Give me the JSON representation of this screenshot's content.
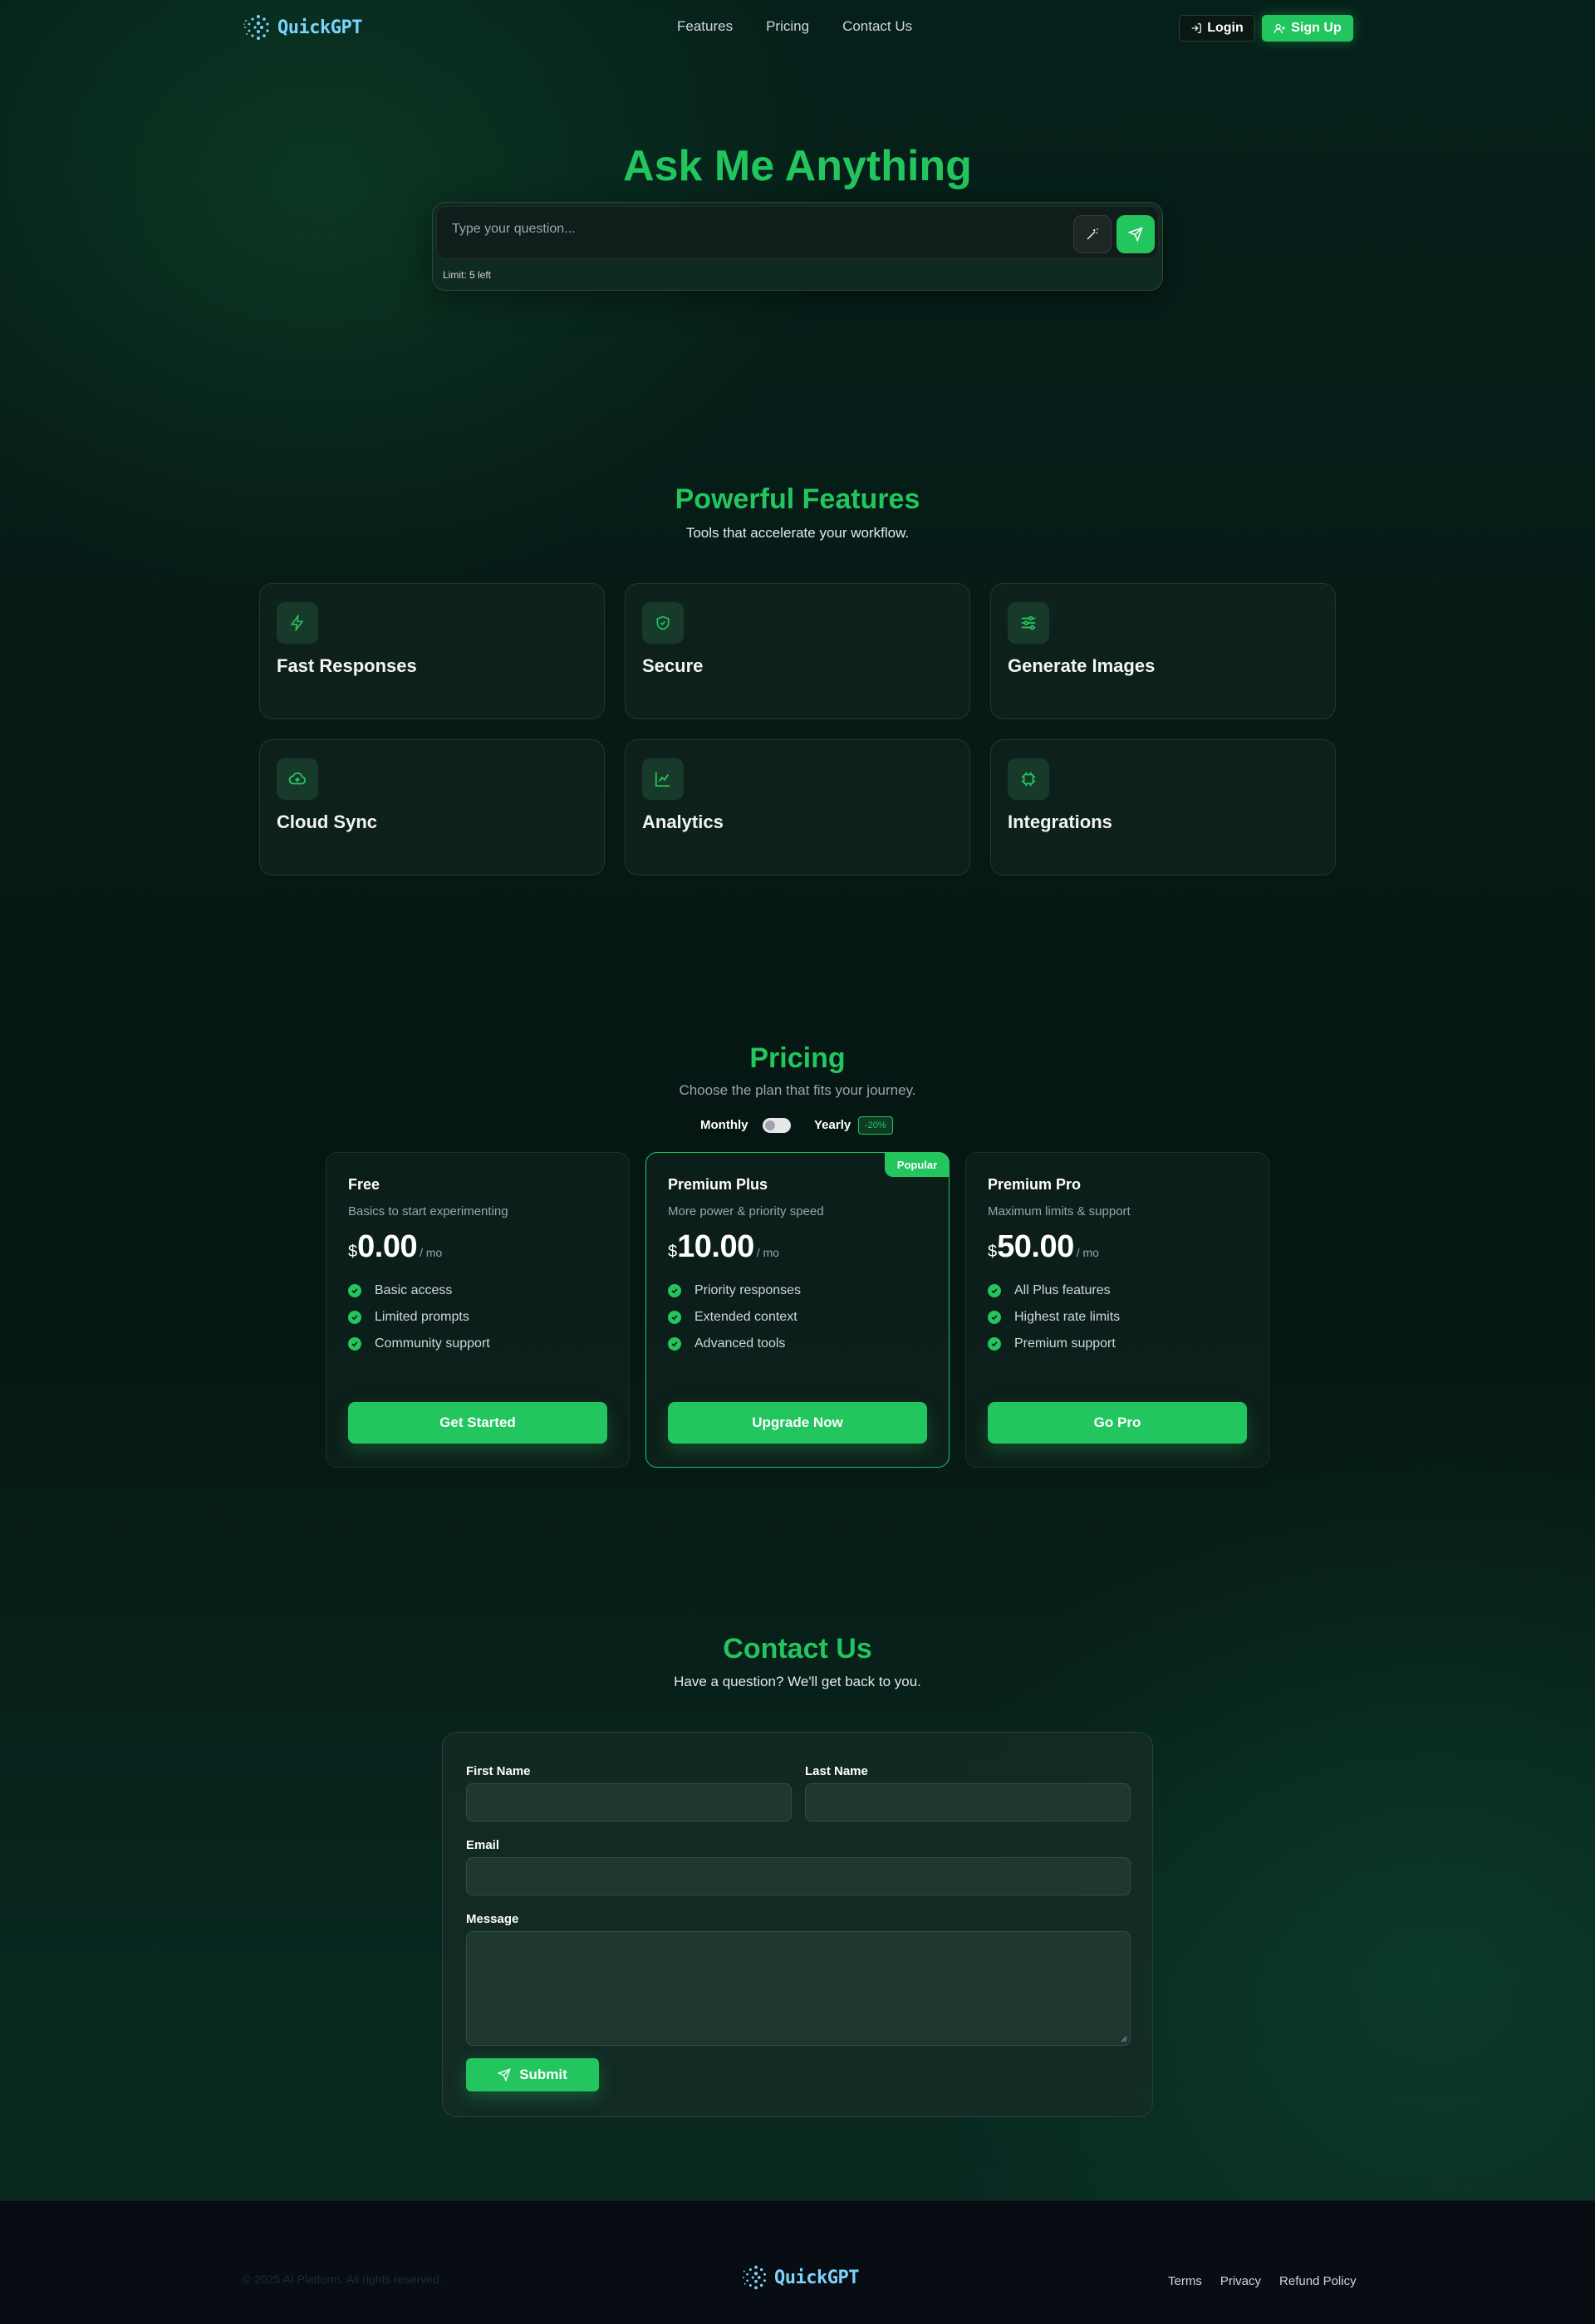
{
  "brand": {
    "name": "QuickGPT"
  },
  "nav": {
    "links": [
      "Features",
      "Pricing",
      "Contact Us"
    ],
    "login_label": "Login",
    "signup_label": "Sign Up"
  },
  "hero": {
    "title": "Ask Me Anything",
    "placeholder": "Type your question...",
    "limit_text": "Limit: 5 left"
  },
  "features": {
    "title": "Powerful Features",
    "subtitle": "Tools that accelerate your workflow.",
    "items": [
      {
        "title": "Fast Responses",
        "icon": "bolt-icon"
      },
      {
        "title": "Secure",
        "icon": "shield-icon"
      },
      {
        "title": "Generate Images",
        "icon": "sliders-icon"
      },
      {
        "title": "Cloud Sync",
        "icon": "cloud-upload-icon"
      },
      {
        "title": "Analytics",
        "icon": "chart-line-icon"
      },
      {
        "title": "Integrations",
        "icon": "chip-icon"
      }
    ]
  },
  "pricing": {
    "title": "Pricing",
    "subtitle": "Choose the plan that fits your journey.",
    "toggle": {
      "monthly": "Monthly",
      "yearly": "Yearly",
      "discount": "-20%",
      "yearly_selected": false
    },
    "plans": [
      {
        "name": "Free",
        "desc": "Basics to start experimenting",
        "currency": "$",
        "amount": "0.00",
        "period": "/ mo",
        "features": [
          "Basic access",
          "Limited prompts",
          "Community support"
        ],
        "cta": "Get Started",
        "popular": false
      },
      {
        "name": "Premium Plus",
        "desc": "More power & priority speed",
        "currency": "$",
        "amount": "10.00",
        "period": "/ mo",
        "features": [
          "Priority responses",
          "Extended context",
          "Advanced tools"
        ],
        "cta": "Upgrade Now",
        "popular": true,
        "badge": "Popular"
      },
      {
        "name": "Premium Pro",
        "desc": "Maximum limits & support",
        "currency": "$",
        "amount": "50.00",
        "period": "/ mo",
        "features": [
          "All Plus features",
          "Highest rate limits",
          "Premium support"
        ],
        "cta": "Go Pro",
        "popular": false
      }
    ]
  },
  "contact": {
    "title": "Contact Us",
    "subtitle": "Have a question? We'll get back to you.",
    "first_name_label": "First Name",
    "last_name_label": "Last Name",
    "email_label": "Email",
    "message_label": "Message",
    "submit_label": "Submit"
  },
  "footer": {
    "copyright": "© 2025 AI Platform. All rights reserved.",
    "links": [
      "Terms",
      "Privacy",
      "Refund Policy"
    ]
  },
  "colors": {
    "accent": "#22c55e",
    "logo": "#7dd3fc"
  }
}
